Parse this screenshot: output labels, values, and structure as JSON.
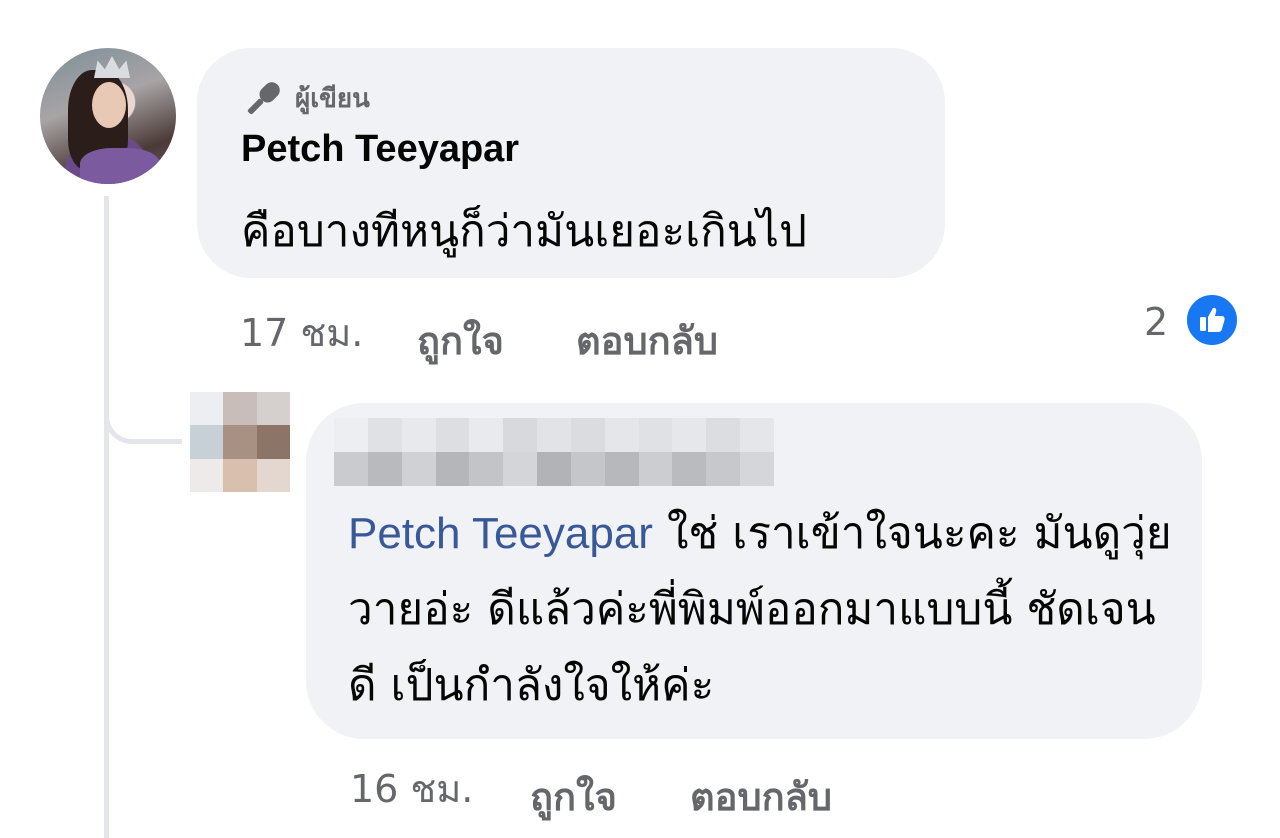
{
  "thread": {
    "comment": {
      "author_badge": "ผู้เขียน",
      "author_name": "Petch Teeyapar",
      "text": "คือบางทีหนูก็ว่ามันเยอะเกินไป",
      "time": "17 ชม.",
      "like_label": "ถูกใจ",
      "reply_label": "ตอบกลับ",
      "reaction_count": "2",
      "reaction_icon": "thumbs-up-icon"
    },
    "reply": {
      "author_name_hidden": true,
      "mention": "Petch Teeyapar",
      "text": " ใช่ เราเข้าใจนะคะ มันดูวุ่ยวายอ่ะ ดีแล้วค่ะพี่พิมพ์ออกมาแบบนี้ ชัดเจนดี เป็นกำลังใจให้ค่ะ",
      "time": "16 ชม.",
      "like_label": "ถูกใจ",
      "reply_label": "ตอบกลับ"
    }
  },
  "colors": {
    "bubble_bg": "#f0f2f5",
    "meta_text": "#65676b",
    "mention": "#385898",
    "like_blue": "#1877f2",
    "thread_line": "#e4e6eb"
  }
}
